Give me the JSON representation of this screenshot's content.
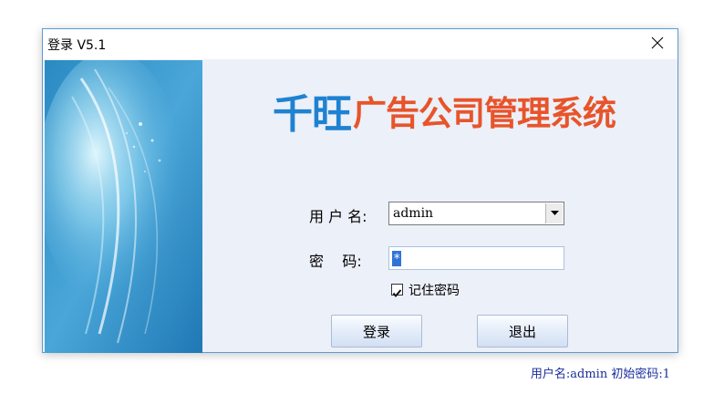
{
  "window": {
    "title": "登录 V5.1",
    "close_icon": "close-icon"
  },
  "logo": {
    "brand": "千旺",
    "rest": "广告公司管理系统",
    "brand_color": "#1e82d2",
    "rest_color": "#e8542a"
  },
  "form": {
    "username_label": "用 户 名:",
    "username_value": "admin",
    "password_label": "密    码:",
    "password_value": "*",
    "remember_label": "记住密码",
    "remember_checked": true
  },
  "buttons": {
    "login": "登录",
    "exit": "退出"
  },
  "hint": "用户名:admin 初始密码:1"
}
